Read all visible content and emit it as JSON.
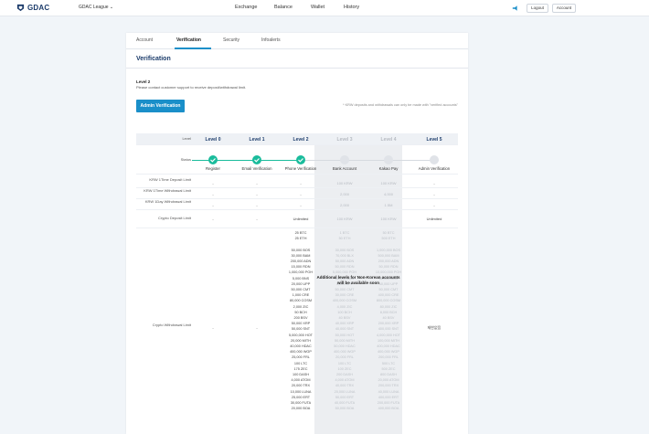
{
  "topbar": {
    "logo_text": "GDAC",
    "league_label": "GDAC League ⌄",
    "nav": [
      "Exchange",
      "Balance",
      "Wallet",
      "History"
    ],
    "logout_label": "Logout",
    "account_label": "Account",
    "brand_color": "#1c3c6b",
    "accent_color": "#1a8fc9"
  },
  "tabs": [
    "Account",
    "Verification",
    "Security",
    "Infoalerts"
  ],
  "active_tab": "Verification",
  "section_title": "Verification",
  "level": {
    "label": "Level 2",
    "description": "Please contact customer support to receive deposit/withdrawal limit."
  },
  "admin_button": "Admin Verification",
  "krw_note": "* KRW deposits and withdrawals can only be made with \"verified accounts\"",
  "table": {
    "level_row_label": "Level",
    "levels": [
      "Level 0",
      "Level 1",
      "Level 2",
      "Level 3",
      "Level 4",
      "Level 5"
    ],
    "status_row_label": "Status",
    "statuses": [
      "Register",
      "Email Verification",
      "Phone Verification",
      "Bank Account",
      "Kakao Pay",
      "Admin Verification"
    ],
    "rows": [
      {
        "label": "KRW 1Time Deposit Limit",
        "values": [
          "-",
          "-",
          "-",
          "100 KRW",
          "100 KRW",
          "-"
        ]
      },
      {
        "label": "KRW 1Time Withdrawal Limit",
        "values": [
          "-",
          "-",
          "-",
          "2,000",
          "4,000",
          "-"
        ]
      },
      {
        "label": "KRW 1Day Withdrawal Limit",
        "values": [
          "-",
          "-",
          "-",
          "2,000",
          "1.5M",
          "-"
        ]
      },
      {
        "label": "Crypto Deposit Limit",
        "values": [
          "-",
          "-",
          "Unlimited",
          "100 KRW",
          "100 KRW",
          "Unlimited"
        ]
      }
    ],
    "withdraw_label": "Crypto Withdrawal Limit",
    "withdraw_l0": "-",
    "withdraw_l1": "-",
    "withdraw_l5": "제한없음",
    "withdraw_l2": [
      "25 BTC",
      "25 ETH",
      "",
      "50,000 BOS",
      "30,000 BAM",
      "200,000 ADN",
      "15,000 RDN",
      "1,000,000 POH",
      "5,000 BNS",
      "20,000 UPP",
      "50,000 CMT",
      "1,000 CRE",
      "80,000 COSM",
      "2,000 ZIC",
      "50 BCH",
      "200 BSV",
      "50,000 XRP",
      "50,000 SNT",
      "5,000,000 HOT",
      "20,000 MITH",
      "40,000 HDAC",
      "400,000 WGP",
      "25,000 FRL",
      "100 LTC",
      "175 ZEC",
      "100 DASH",
      "4,000 ATOM",
      "20,000 TRX",
      "10,000 LUNA",
      "25,000 ERT",
      "30,000 FUTA",
      "20,000 BOA"
    ],
    "withdraw_l3": [
      "1 BTC",
      "50 ETH",
      "",
      "30,000 BOS",
      "70,000 BLX",
      "50,000 ADN",
      "50,000 RDN",
      "5,000,000 POH",
      "10,000 BNS",
      "5,000 UPP",
      "50,000 CMT",
      "30,000 CRE",
      "400,000 COSM",
      "4,000 ZIC",
      "100 BCH",
      "40 BSV",
      "40,000 XRP",
      "40,000 SNT",
      "50,000 HOT",
      "50,000 MITH",
      "50,000 HDAC",
      "400,000 WGP",
      "20,000 FRL",
      "100 LTC",
      "100 ZEC",
      "200 DASH",
      "4,000 ATOM",
      "40,000 TRX",
      "20,000 LUNA",
      "50,000 ERT",
      "40,000 FUTA",
      "50,000 BOA"
    ],
    "withdraw_l4": [
      "50 BTC",
      "500 ETH",
      "",
      "1,000,000 BOS",
      "500,000 BAM",
      "200,000 ADN",
      "50,000 RDN",
      "10,000,000 POH",
      "50,000 BNS",
      "40,000 UPP",
      "50,000 CMT",
      "400,000 CRE",
      "800,000 COSM",
      "80,000 ZIC",
      "8,000 BCH",
      "40 BSV",
      "200,000 XRP",
      "400,000 SNT",
      "4,000,000 HOT",
      "100,000 MITH",
      "400,000 HDAC",
      "400,000 WGP",
      "200,000 FRL",
      "500 LTC",
      "500 ZEC",
      "800 DASH",
      "20,000 ATOM",
      "200,000 TRX",
      "40,000 LUNA",
      "400,000 ERT",
      "200,000 FUTA",
      "400,000 BOA"
    ],
    "overlay": "Additional levels for Non-Korean accounts will be available soon"
  }
}
